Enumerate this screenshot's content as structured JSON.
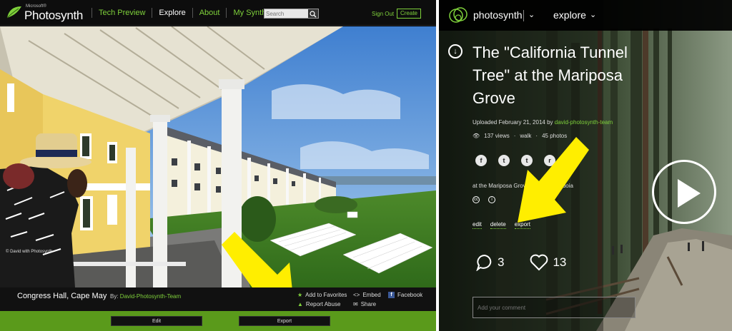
{
  "left": {
    "brand": {
      "ms_label": "Microsoft®",
      "name": "Photosynth"
    },
    "nav": [
      {
        "label": "Tech Preview",
        "color": "#7fd13b"
      },
      {
        "label": "Explore",
        "color": "#ffffff"
      },
      {
        "label": "About",
        "color": "#7fd13b"
      },
      {
        "label": "My Synths",
        "color": "#7fd13b"
      }
    ],
    "search": {
      "placeholder": "Search"
    },
    "sign_out": "Sign Out",
    "create": "Create",
    "watermark": "© David with Photosynth",
    "info": {
      "title": "Congress Hall, Cape May",
      "by_label": "By:",
      "author": "David-Photosynth-Team",
      "actions": {
        "favorites": "Add to Favorites",
        "report": "Report Abuse",
        "embed": "Embed",
        "share": "Share",
        "facebook": "Facebook"
      }
    },
    "bottom_buttons": {
      "edit": "Edit",
      "export": "Export"
    },
    "accent_color": "#7fd13b",
    "bottom_bar_color": "#5a9a1b"
  },
  "right": {
    "brand": "photosynth",
    "explore": "explore",
    "title": "The \"California Tunnel Tree\" at the Mariposa Grove",
    "uploaded_prefix": "Uploaded February 21, 2014 by",
    "author": "david-photosynth-team",
    "stats": {
      "views": "137 views",
      "mode": "walk",
      "photos": "45 photos"
    },
    "share_icons": [
      "facebook-icon",
      "twitter-icon",
      "tumblr-icon",
      "reddit-icon"
    ],
    "location": "at the Mariposa Grove of Giant Sequoia",
    "links": {
      "edit": "edit",
      "delete": "delete",
      "export": "export"
    },
    "comments_count": "3",
    "likes_count": "13",
    "comment_placeholder": "Add your comment"
  }
}
